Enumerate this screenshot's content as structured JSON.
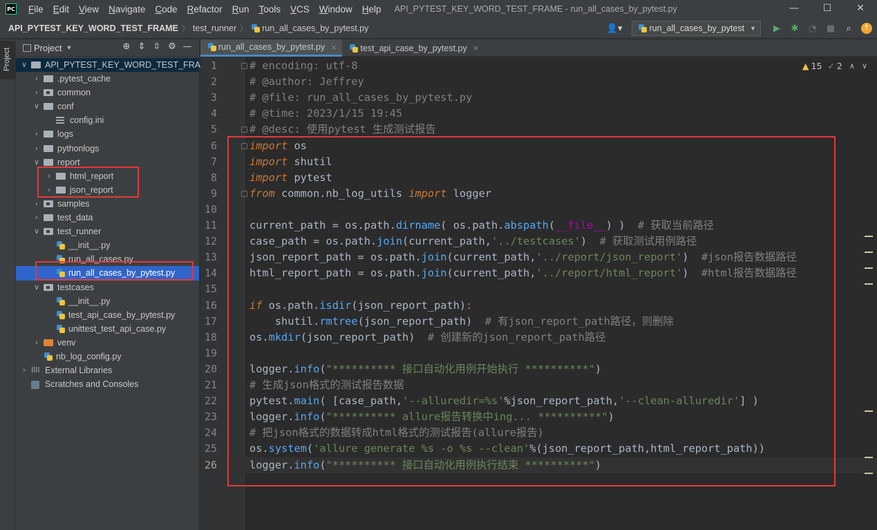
{
  "titlebar": {
    "logo": "PC",
    "menu": [
      {
        "first": "F",
        "rest": "ile"
      },
      {
        "first": "E",
        "rest": "dit"
      },
      {
        "first": "V",
        "rest": "iew"
      },
      {
        "first": "N",
        "rest": "avigate"
      },
      {
        "first": "C",
        "rest": "ode"
      },
      {
        "first": "R",
        "rest": "efactor"
      },
      {
        "first": "R",
        "rest": "un"
      },
      {
        "first": "T",
        "rest": "ools"
      },
      {
        "first": "V",
        "rest": "CS"
      },
      {
        "first": "W",
        "rest": "indow"
      },
      {
        "first": "H",
        "rest": "elp"
      }
    ],
    "window_title": "API_PYTEST_KEY_WORD_TEST_FRAME - run_all_cases_by_pytest.py",
    "controls": {
      "minimize": "—",
      "maximize": "☐",
      "close": "✕"
    }
  },
  "navbar": {
    "root": "API_PYTEST_KEY_WORD_TEST_FRAME",
    "folder": "test_runner",
    "file": "run_all_cases_by_pytest.py",
    "run_config": "run_all_cases_by_pytest"
  },
  "toolstrip": {
    "project_tab": "Project"
  },
  "project_panel": {
    "title": "Project"
  },
  "tree": [
    {
      "label": "API_PYTEST_KEY_WORD_TEST_FRAME",
      "arrow": "∨"
    },
    {
      "label": ".pytest_cache",
      "arrow": "›"
    },
    {
      "label": "common",
      "arrow": "›"
    },
    {
      "label": "conf",
      "arrow": "∨"
    },
    {
      "label": "config.ini",
      "arrow": ""
    },
    {
      "label": "logs",
      "arrow": "›"
    },
    {
      "label": "pythonlogs",
      "arrow": "›"
    },
    {
      "label": "report",
      "arrow": "∨"
    },
    {
      "label": "html_report",
      "arrow": "›"
    },
    {
      "label": "json_report",
      "arrow": "›"
    },
    {
      "label": "samples",
      "arrow": "›"
    },
    {
      "label": "test_data",
      "arrow": "›"
    },
    {
      "label": "test_runner",
      "arrow": "∨"
    },
    {
      "label": "__init__.py",
      "arrow": ""
    },
    {
      "label": "run_all_cases.py",
      "arrow": ""
    },
    {
      "label": "run_all_cases_by_pytest.py",
      "arrow": ""
    },
    {
      "label": "testcases",
      "arrow": "∨"
    },
    {
      "label": "__init__.py",
      "arrow": ""
    },
    {
      "label": "test_api_case_by_pytest.py",
      "arrow": ""
    },
    {
      "label": "unittest_test_api_case.py",
      "arrow": ""
    },
    {
      "label": "venv",
      "arrow": "›"
    },
    {
      "label": "nb_log_config.py",
      "arrow": ""
    },
    {
      "label": "External Libraries",
      "arrow": "›"
    },
    {
      "label": "Scratches and Consoles",
      "arrow": ""
    }
  ],
  "editor_tabs": [
    {
      "label": "run_all_cases_by_pytest.py",
      "close": "×"
    },
    {
      "label": "test_api_case_by_pytest.py",
      "close": "×"
    }
  ],
  "inspections": {
    "warnings": "15",
    "weak": "2"
  },
  "code_lines": [
    [
      [
        "c-cm",
        "# encoding: utf-8"
      ]
    ],
    [
      [
        "c-cm",
        "# @author: Jeffrey"
      ]
    ],
    [
      [
        "c-cm",
        "# @file: run_all_cases_by_pytest.py"
      ]
    ],
    [
      [
        "c-cm",
        "# @time: 2023/1/15 19:45"
      ]
    ],
    [
      [
        "c-cm",
        "# @desc: 使用pytest 生成测试报告"
      ]
    ],
    [
      [
        "c-kwi",
        "import"
      ],
      [
        "",
        " os"
      ]
    ],
    [
      [
        "c-kwi",
        "import"
      ],
      [
        "",
        " shutil"
      ]
    ],
    [
      [
        "c-kwi",
        "import"
      ],
      [
        "",
        " pytest"
      ]
    ],
    [
      [
        "c-kwi",
        "from"
      ],
      [
        "",
        " common.nb_log_utils "
      ],
      [
        "c-kwi",
        "import"
      ],
      [
        "",
        " logger"
      ]
    ],
    [],
    [
      [
        "",
        "current_path = os.path."
      ],
      [
        "c-mth",
        "dirname"
      ],
      [
        "",
        "( os.path."
      ],
      [
        "c-mth",
        "abspath"
      ],
      [
        "",
        "("
      ],
      [
        "c-magic",
        "__file__"
      ],
      [
        "",
        ") )  "
      ],
      [
        "c-cm",
        "# 获取当前路径"
      ]
    ],
    [
      [
        "",
        "case_path = os.path."
      ],
      [
        "c-mth",
        "join"
      ],
      [
        "",
        "(current_path,"
      ],
      [
        "c-str",
        "'../testcases'"
      ],
      [
        "",
        ")  "
      ],
      [
        "c-cm",
        "# 获取测试用例路径"
      ]
    ],
    [
      [
        "",
        "json_report_path = os.path."
      ],
      [
        "c-mth",
        "join"
      ],
      [
        "",
        "(current_path,"
      ],
      [
        "c-str",
        "'../report/json_report'"
      ],
      [
        "",
        ")  "
      ],
      [
        "c-cm",
        "#json报告数据路径"
      ]
    ],
    [
      [
        "",
        "html_report_path = os.path."
      ],
      [
        "c-mth",
        "join"
      ],
      [
        "",
        "(current_path,"
      ],
      [
        "c-str",
        "'../report/html_report'"
      ],
      [
        "",
        ")  "
      ],
      [
        "c-cm",
        "#html报告数据路径"
      ]
    ],
    [],
    [
      [
        "c-kwi",
        "if"
      ],
      [
        "",
        " os.path."
      ],
      [
        "c-mth",
        "isdir"
      ],
      [
        "",
        "(json_report_path)"
      ],
      [
        "c-kw",
        ":"
      ]
    ],
    [
      [
        "",
        "    shutil."
      ],
      [
        "c-mth",
        "rmtree"
      ],
      [
        "",
        "(json_report_path)  "
      ],
      [
        "c-cm",
        "# 有json_report_path路径，则删除"
      ]
    ],
    [
      [
        "",
        "os."
      ],
      [
        "c-mth",
        "mkdir"
      ],
      [
        "",
        "(json_report_path)  "
      ],
      [
        "c-cm",
        "# 创建新的json_report_path路径"
      ]
    ],
    [],
    [
      [
        "",
        "logger."
      ],
      [
        "c-mth",
        "info"
      ],
      [
        "",
        "("
      ],
      [
        "c-str",
        "\"********** 接口自动化用例开始执行 **********\""
      ],
      [
        "",
        ")"
      ]
    ],
    [
      [
        "c-cm",
        "# 生成json格式的测试报告数据"
      ]
    ],
    [
      [
        "",
        "pytest."
      ],
      [
        "c-mth",
        "main"
      ],
      [
        "",
        "( [case_path,"
      ],
      [
        "c-str",
        "'--alluredir=%s'"
      ],
      [
        "",
        "%json_report_path,"
      ],
      [
        "c-str",
        "'--clean-alluredir'"
      ],
      [
        "",
        "] )"
      ]
    ],
    [
      [
        "",
        "logger."
      ],
      [
        "c-mth",
        "info"
      ],
      [
        "",
        "("
      ],
      [
        "c-str",
        "\"********** allure报告转换中ing... **********\""
      ],
      [
        "",
        ")"
      ]
    ],
    [
      [
        "c-cm",
        "# 把json格式的数据转成html格式的测试报告(allure报告)"
      ]
    ],
    [
      [
        "",
        "os."
      ],
      [
        "c-mth",
        "system"
      ],
      [
        "",
        "("
      ],
      [
        "c-str",
        "'allure generate %s -o %s --clean'"
      ],
      [
        "",
        "%(json_report_path,html_report_path))"
      ]
    ],
    [
      [
        "",
        "logger."
      ],
      [
        "c-mth",
        "info"
      ],
      [
        "",
        "("
      ],
      [
        "c-str",
        "\"********** 接口自动化用例执行结束 **********\""
      ],
      [
        "",
        ")"
      ]
    ]
  ],
  "colors": {
    "accent": "#2f65ca",
    "annotation": "#e3393b",
    "keyword": "#cc7832",
    "string": "#6a8759",
    "comment": "#808080"
  }
}
